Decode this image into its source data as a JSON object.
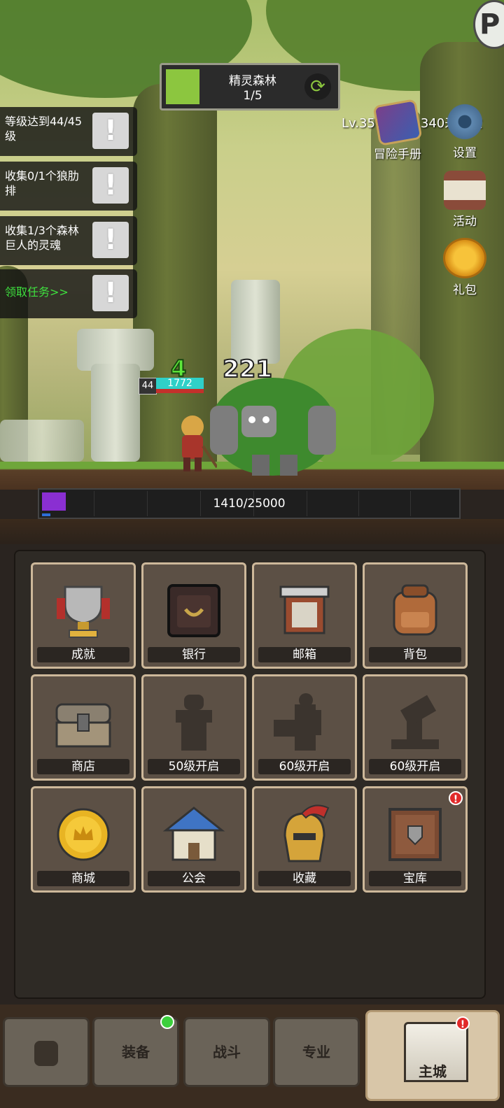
{
  "stage": {
    "name": "精灵森林",
    "progress": "1/5"
  },
  "corner_logo": "P",
  "quests": [
    {
      "text": "等级达到44/45级",
      "style": "normal"
    },
    {
      "text": "收集0/1个狼肋排",
      "style": "normal"
    },
    {
      "text": "收集1/3个森林巨人的灵魂",
      "style": "normal"
    },
    {
      "text": "领取任务>>",
      "style": "green"
    }
  ],
  "quest_button_glyph": "!",
  "player": {
    "info": "Lv.350 牧师: 340来义父"
  },
  "side_buttons": [
    {
      "label": "冒险手册",
      "icon": "book-icon"
    },
    {
      "label": "设置",
      "icon": "gear-icon"
    },
    {
      "label": "活动",
      "icon": "scroll-icon"
    },
    {
      "label": "礼包",
      "icon": "coin-bag-icon"
    }
  ],
  "battle": {
    "hero_level": "44",
    "hero_hp": "1772",
    "heal_popup": "4",
    "damage_popup": "221"
  },
  "xp": {
    "text": "1410/25000",
    "fraction": 0.0564
  },
  "menu_tiles": [
    {
      "label": "成就",
      "icon": "trophy-icon",
      "badge": null
    },
    {
      "label": "银行",
      "icon": "safe-icon",
      "badge": null
    },
    {
      "label": "邮箱",
      "icon": "mailbox-icon",
      "badge": null
    },
    {
      "label": "背包",
      "icon": "backpack-icon",
      "badge": null
    },
    {
      "label": "商店",
      "icon": "chest-icon",
      "badge": null
    },
    {
      "label": "50级开启",
      "icon": "locked-silhouette-icon",
      "badge": null
    },
    {
      "label": "60级开启",
      "icon": "locked-silhouette-icon",
      "badge": null
    },
    {
      "label": "60级开启",
      "icon": "locked-silhouette-icon",
      "badge": null
    },
    {
      "label": "商城",
      "icon": "gold-coin-icon",
      "badge": null
    },
    {
      "label": "公会",
      "icon": "guild-house-icon",
      "badge": null
    },
    {
      "label": "收藏",
      "icon": "helmet-icon",
      "badge": null
    },
    {
      "label": "宝库",
      "icon": "treasury-icon",
      "badge": "!"
    }
  ],
  "bottom_nav": [
    {
      "label": "",
      "icon": "lock-icon",
      "badge": null,
      "active": false
    },
    {
      "label": "装备",
      "icon": "",
      "badge": "green",
      "active": false
    },
    {
      "label": "战斗",
      "icon": "",
      "badge": null,
      "active": false
    },
    {
      "label": "专业",
      "icon": "",
      "badge": null,
      "active": false
    },
    {
      "label": "主城",
      "icon": "castle-icon",
      "badge": "!",
      "active": true
    }
  ],
  "colors": {
    "xp_fill": "#8a2fd2",
    "stage_green": "#8cc63f",
    "quest_link": "#3ee03e",
    "badge_red": "#e12a2a"
  }
}
